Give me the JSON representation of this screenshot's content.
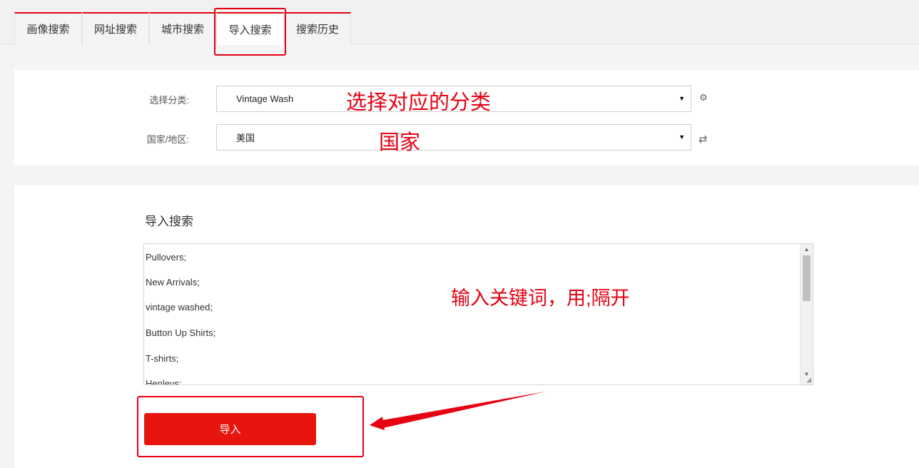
{
  "tabs": [
    {
      "label": "画像搜索"
    },
    {
      "label": "网址搜索"
    },
    {
      "label": "城市搜索"
    },
    {
      "label": "导入搜索"
    },
    {
      "label": "搜索历史"
    }
  ],
  "form": {
    "category_label": "选择分类:",
    "category_value": "Vintage Wash",
    "country_label": "国家/地区:",
    "country_value": "美国"
  },
  "annotations": {
    "category_note": "选择对应的分类",
    "country_note": "国家",
    "keywords_note": "输入关键词，用;隔开"
  },
  "import_section": {
    "title": "导入搜索",
    "keywords": [
      "Pullovers;",
      "New Arrivals;",
      "vintage washed;",
      "Button Up Shirts;",
      "T-shirts;",
      "Henleys;"
    ],
    "button_label": "导入"
  },
  "colors": {
    "accent": "#e60012",
    "button": "#e8150e"
  }
}
